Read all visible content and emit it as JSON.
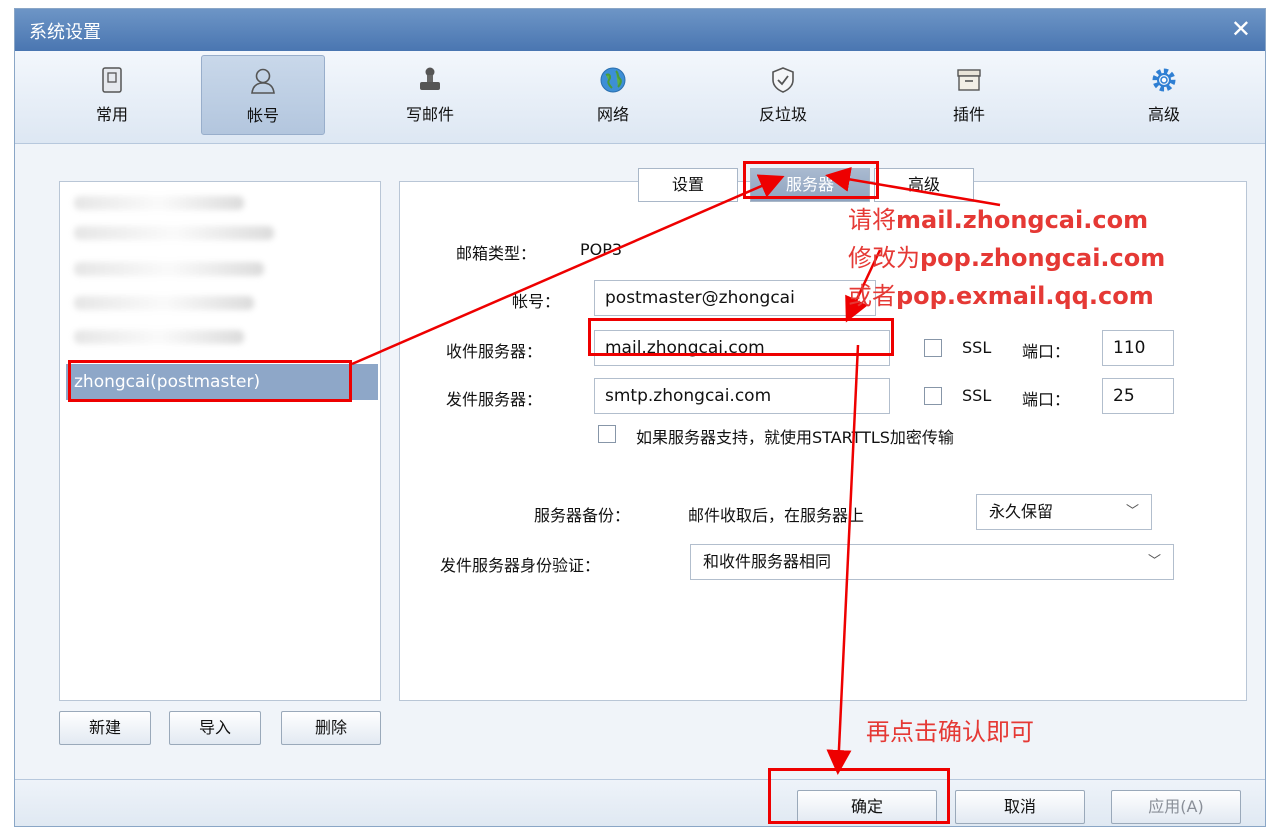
{
  "window": {
    "title": "系统设置",
    "close_label": "✕"
  },
  "toolbar": {
    "items": [
      {
        "label": "常用",
        "icon": "phone-icon"
      },
      {
        "label": "帐号",
        "icon": "user-icon",
        "active": true
      },
      {
        "label": "写邮件",
        "icon": "stamp-icon"
      },
      {
        "label": "网络",
        "icon": "globe-icon"
      },
      {
        "label": "反垃圾",
        "icon": "shield-icon"
      },
      {
        "label": "插件",
        "icon": "box-icon"
      },
      {
        "label": "高级",
        "icon": "gear-icon"
      }
    ]
  },
  "accounts": {
    "selected": "zhongcai(postmaster)",
    "new_label": "新建",
    "import_label": "导入",
    "delete_label": "删除"
  },
  "tabs": {
    "settings": "设置",
    "server": "服务器",
    "advanced": "高级"
  },
  "form": {
    "mailbox_type_label": "邮箱类型：",
    "mailbox_type_value": "POP3",
    "account_label": "帐号：",
    "account_value": "postmaster@zhongcai",
    "incoming_label": "收件服务器：",
    "incoming_value": "mail.zhongcai.com",
    "outgoing_label": "发件服务器：",
    "outgoing_value": "smtp.zhongcai.com",
    "ssl_label": "SSL",
    "port_label": "端口：",
    "incoming_port": "110",
    "outgoing_port": "25",
    "starttls_label": "如果服务器支持，就使用STARTTLS加密传输",
    "backup_label": "服务器备份：",
    "backup_desc": "邮件收取后，在服务器上",
    "backup_value": "永久保留",
    "auth_label": "发件服务器身份验证：",
    "auth_value": "和收件服务器相同"
  },
  "footer": {
    "ok_label": "确定",
    "cancel_label": "取消",
    "apply_label": "应用(A)"
  },
  "annotations": {
    "line1_prefix": "请将",
    "line1_value": "mail.zhongcai.com",
    "line2_prefix": "修改为",
    "line2_value": "pop.zhongcai.com",
    "line3_prefix": "或者",
    "line3_value": "pop.exmail.qq.com",
    "confirm": "再点击确认即可"
  },
  "colors": {
    "annotation": "#e53935",
    "highlight_box": "#ee0000",
    "accent": "#4a76b1"
  }
}
